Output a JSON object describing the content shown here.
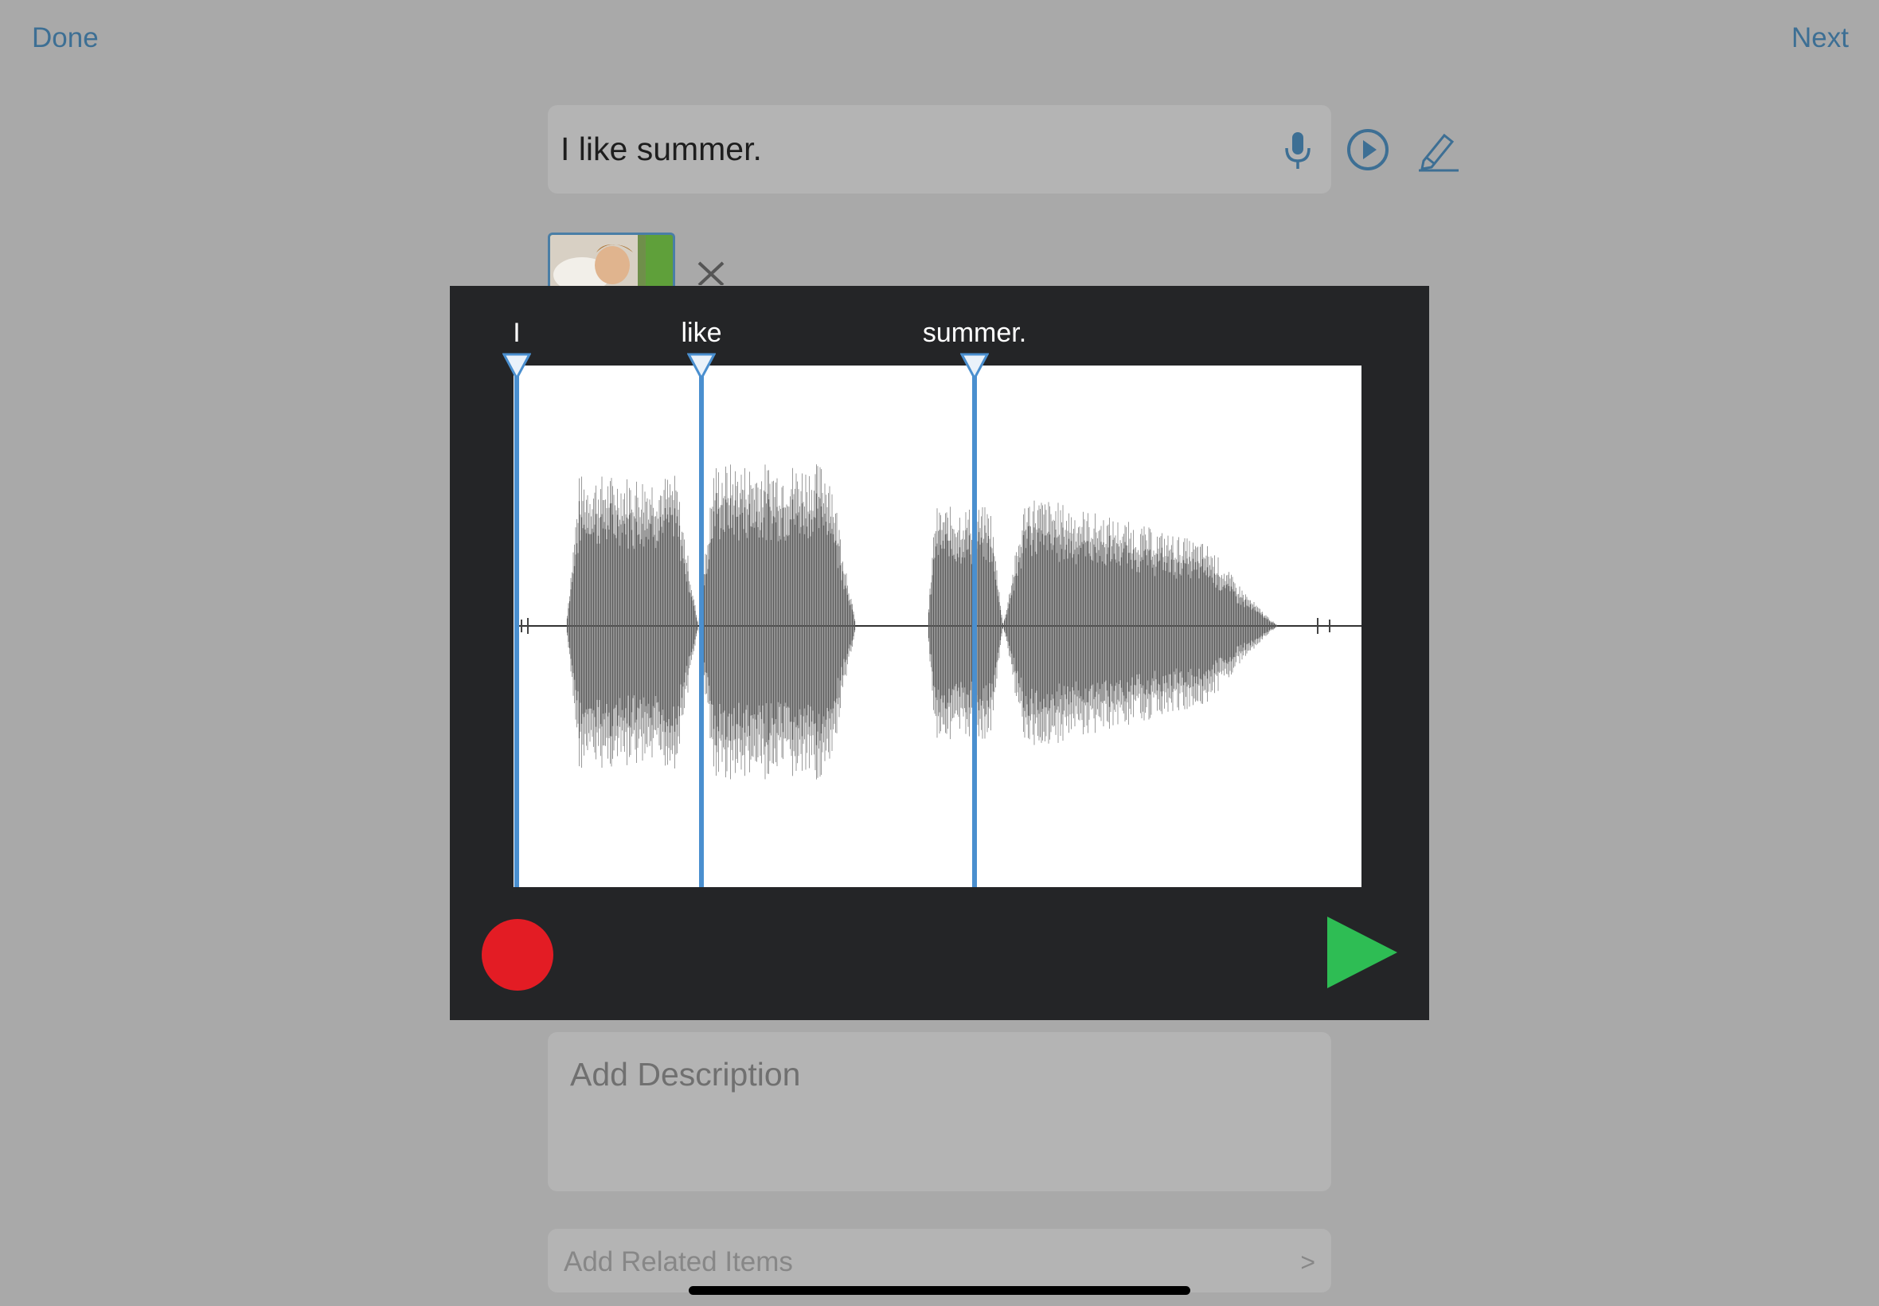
{
  "nav": {
    "done_label": "Done",
    "next_label": "Next"
  },
  "sentence": {
    "text": "I like summer."
  },
  "toolbar": {
    "icons": [
      "microphone-icon",
      "play-circle-icon",
      "pencil-icon"
    ]
  },
  "audio_editor": {
    "words": [
      "I",
      "like",
      "summer."
    ],
    "colors": {
      "marker": "#4a8fcf",
      "record": "#e31c24",
      "play": "#2ebd54",
      "background": "#242527"
    }
  },
  "description": {
    "placeholder": "Add Description"
  },
  "related": {
    "label": "Add Related Items",
    "chevron": ">"
  }
}
